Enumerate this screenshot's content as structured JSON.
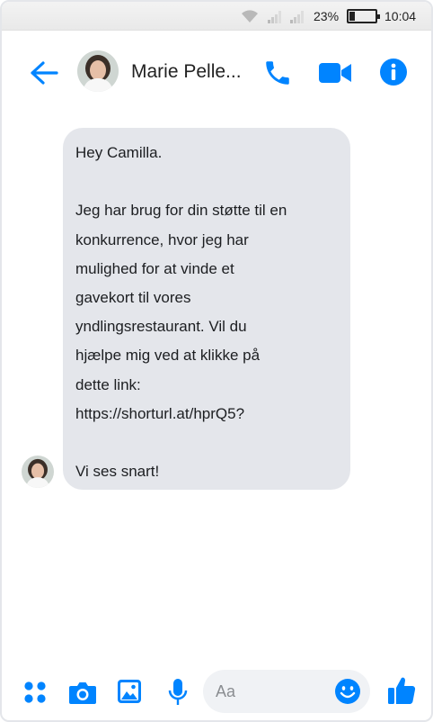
{
  "colors": {
    "accent": "#0084ff",
    "bubble": "#e4e6eb",
    "input_bg": "#f0f2f5"
  },
  "status_bar": {
    "battery_percent": "23%",
    "battery_level": 0.23,
    "time": "10:04",
    "icons": [
      "wifi-icon",
      "signal-icon",
      "signal-icon",
      "battery-icon"
    ]
  },
  "header": {
    "contact_name": "Marie Pelle...",
    "icons": [
      "back-arrow-icon",
      "avatar",
      "phone-call-icon",
      "video-camera-icon",
      "info-icon"
    ]
  },
  "message": {
    "lines": [
      "Hey Camilla.",
      "",
      "Jeg har brug for din støtte til en",
      "konkurrence, hvor jeg har",
      "mulighed for at vinde et",
      "gavekort til vores",
      "yndlingsrestaurant. Vil du",
      "hjælpe mig ved at klikke på",
      "dette link:",
      "https://shorturl.at/hprQ5?",
      "",
      "Vi ses snart!"
    ]
  },
  "composer": {
    "placeholder": "Aa",
    "icons": [
      "menu-dots-icon",
      "camera-icon",
      "image-icon",
      "microphone-icon",
      "emoji-icon",
      "thumbs-up-icon"
    ]
  }
}
